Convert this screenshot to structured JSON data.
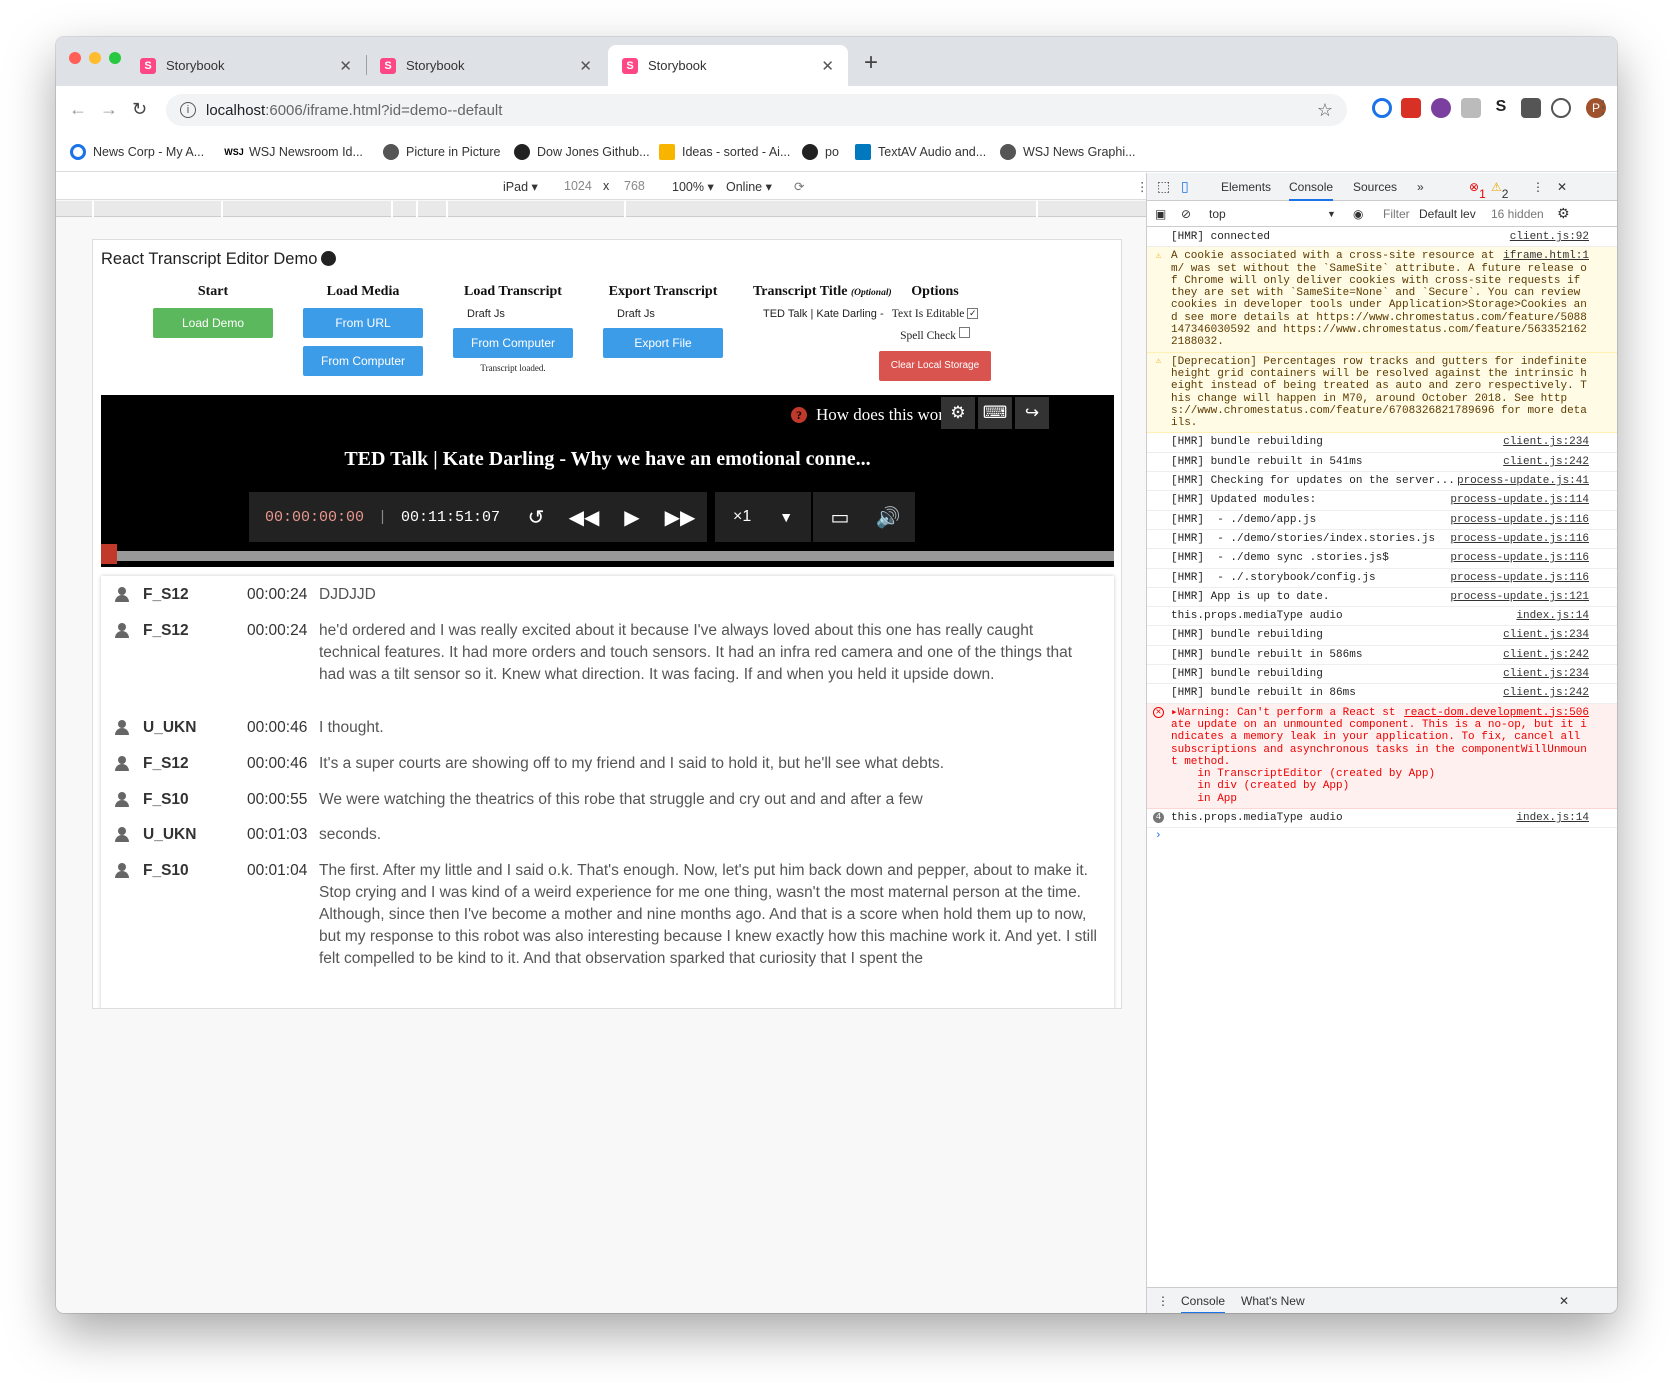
{
  "browser": {
    "tabs": [
      {
        "label": "Storybook",
        "icon": "S"
      },
      {
        "label": "Storybook",
        "icon": "S"
      },
      {
        "label": "Storybook",
        "icon": "S"
      }
    ],
    "url_host": "localhost",
    "url_rest": ":6006/iframe.html?id=demo--default",
    "bookmarks": [
      "News Corp - My A...",
      "WSJ Newsroom Id...",
      "Picture in Picture",
      "Dow Jones Github...",
      "Ideas - sorted - Ai...",
      "po",
      "TextAV Audio and...",
      "WSJ News Graphi..."
    ],
    "avatar_letter": "P"
  },
  "device_bar": {
    "device": "iPad ▾",
    "width": "1024",
    "times": "x",
    "height": "768",
    "zoom": "100% ▾",
    "network": "Online ▾"
  },
  "demo": {
    "title": "React Transcript Editor Demo",
    "start": {
      "heading": "Start",
      "button": "Load Demo"
    },
    "load_media": {
      "heading": "Load Media",
      "from_url": "From URL",
      "from_computer": "From Computer"
    },
    "load_transcript": {
      "heading": "Load Transcript",
      "format": "Draft Js",
      "button": "From Computer",
      "status": "Transcript loaded."
    },
    "export_transcript": {
      "heading": "Export Transcript",
      "format": "Draft Js",
      "button": "Export File"
    },
    "transcript_title": {
      "heading": "Transcript Title",
      "optional": "(Optional)",
      "value": "TED Talk | Kate Darling -"
    },
    "options": {
      "heading": "Options",
      "editable": "Text Is Editable",
      "spell": "Spell Check",
      "clear": "Clear Local Storage"
    }
  },
  "player": {
    "help": "How does this work?",
    "title": "TED Talk | Kate Darling - Why we have an emotional conne...",
    "current_time": "00:00:00:00",
    "separator": "|",
    "duration": "00:11:51:07",
    "playback_rate": "×1",
    "progress_fraction": 0
  },
  "transcript": [
    {
      "speaker": "F_S12",
      "time": "00:00:24",
      "text": "DJDJJD"
    },
    {
      "speaker": "F_S12",
      "time": "00:00:24",
      "text": "he'd ordered and I was really excited about it because I've always loved about this one has really caught technical features. It had more orders and touch sensors. It had an infra red camera and one of the things that had was a tilt sensor so it. Knew what direction. It was facing. If and when you held it upside down."
    },
    {
      "speaker": "U_UKN",
      "time": "00:00:46",
      "text": "I thought."
    },
    {
      "speaker": "F_S12",
      "time": "00:00:46",
      "text": "It's a super courts are showing off to my friend and I said to hold it, but he'll see what debts."
    },
    {
      "speaker": "F_S10",
      "time": "00:00:55",
      "text": "We were watching the theatrics of this robe that struggle and cry out and and after a few"
    },
    {
      "speaker": "U_UKN",
      "time": "00:01:03",
      "text": "seconds."
    },
    {
      "speaker": "F_S10",
      "time": "00:01:04",
      "text": "The first. After my little and I said o.k. That's enough. Now, let's put him back down and pepper, about to make it. Stop crying and I was kind of a weird experience for me one thing, wasn't the most maternal person at the time. Although, since then I've become a mother and nine months ago. And that is a score when hold them up to now, but my response to this robot was also interesting because I knew exactly how this machine work it. And yet. I still felt compelled to be kind to it. And that observation sparked that curiosity that I spent the"
    }
  ],
  "devtools": {
    "tabs": [
      "Elements",
      "Console",
      "Sources",
      "»"
    ],
    "errors": "1",
    "warnings": "2",
    "context": "top",
    "filter": "Filter",
    "levels": "Default lev",
    "hidden": "16 hidden",
    "messages": [
      {
        "type": "log",
        "text": "[HMR] connected",
        "src": "client.js:92"
      },
      {
        "type": "warn",
        "text": "A cookie associated with a cross-site resource at http://ted.com/ was set without the `SameSite` attribute. A future release of Chrome will only deliver cookies with cross-site requests if they are set with `SameSite=None` and `Secure`. You can review cookies in developer tools under Application>Storage>Cookies and see more details at https://www.chromestatus.com/feature/5088147346030592 and https://www.chromestatus.com/feature/5633521622188032.",
        "src": "iframe.html:1"
      },
      {
        "type": "warn",
        "text": "[Deprecation] Percentages row tracks and gutters for indefinite height grid containers will be resolved against the intrinsic height instead of being treated as auto and zero respectively. This change will happen in M70, around October 2018. See https://www.chromestatus.com/feature/6708326821789696 for more details.",
        "src": ""
      },
      {
        "type": "log",
        "text": "[HMR] bundle rebuilding",
        "src": "client.js:234"
      },
      {
        "type": "log",
        "text": "[HMR] bundle rebuilt in 541ms",
        "src": "client.js:242"
      },
      {
        "type": "log",
        "text": "[HMR] Checking for updates on the server...",
        "src": "process-update.js:41"
      },
      {
        "type": "log",
        "text": "[HMR] Updated modules:",
        "src": "process-update.js:114"
      },
      {
        "type": "log",
        "text": "[HMR]  - ./demo/app.js",
        "src": "process-update.js:116"
      },
      {
        "type": "log",
        "text": "[HMR]  - ./demo/stories/index.stories.js",
        "src": "process-update.js:116"
      },
      {
        "type": "log",
        "text": "[HMR]  - ./demo sync .stories.js$",
        "src": "process-update.js:116"
      },
      {
        "type": "log",
        "text": "[HMR]  - ./.storybook/config.js",
        "src": "process-update.js:116"
      },
      {
        "type": "log",
        "text": "[HMR] App is up to date.",
        "src": "process-update.js:121"
      },
      {
        "type": "log",
        "text": "this.props.mediaType audio",
        "src": "index.js:14"
      },
      {
        "type": "log",
        "text": "[HMR] bundle rebuilding",
        "src": "client.js:234"
      },
      {
        "type": "log",
        "text": "[HMR] bundle rebuilt in 586ms",
        "src": "client.js:242"
      },
      {
        "type": "log",
        "text": "[HMR] bundle rebuilding",
        "src": "client.js:234"
      },
      {
        "type": "log",
        "text": "[HMR] bundle rebuilt in 86ms",
        "src": "client.js:242"
      },
      {
        "type": "err",
        "text": "▸Warning: Can't perform a React state update on an unmounted component. This is a no-op, but it indicates a memory leak in your application. To fix, cancel all subscriptions and asynchronous tasks in the componentWillUnmount method.\n    in TranscriptEditor (created by App)\n    in div (created by App)\n    in App",
        "src": "react-dom.development.js:506"
      },
      {
        "type": "info",
        "text": "this.props.mediaType audio",
        "src": "index.js:14",
        "badge": "4"
      }
    ],
    "drawer_tabs": [
      "Console",
      "What's New"
    ]
  }
}
